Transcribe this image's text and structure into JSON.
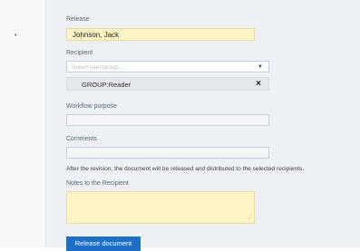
{
  "left_marker": "•",
  "form": {
    "release_label": "Release",
    "release_value": "Johnson, Jack",
    "recipient_label": "Recipient",
    "recipient_placeholder": "Select user/group...",
    "recipient_chip": "GROUP:Reader",
    "chip_remove": "×",
    "workflow_purpose_label": "Workflow purpose",
    "comments_label": "Comments",
    "notice": "After the revision, the document will be released and distributed to the selected recipients.",
    "notes_label": "Notes to the Recipient",
    "release_button": "Release document"
  }
}
